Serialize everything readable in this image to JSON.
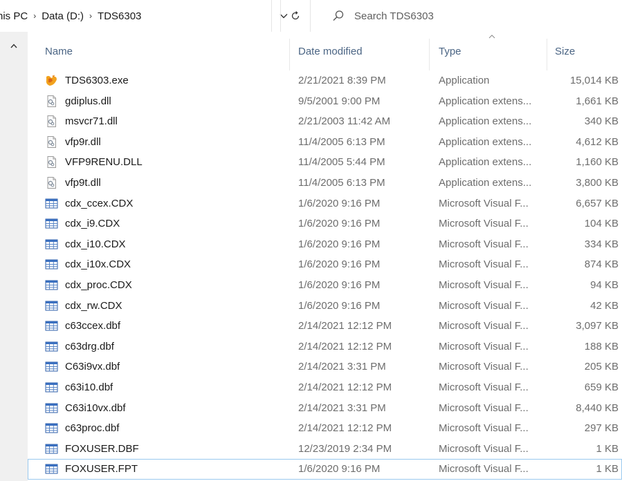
{
  "breadcrumb": [
    "his PC",
    "Data (D:)",
    "TDS6303"
  ],
  "search": {
    "placeholder": "Search TDS6303"
  },
  "columns": {
    "name": "Name",
    "date": "Date modified",
    "type": "Type",
    "size": "Size"
  },
  "colors": {
    "header_text": "#4b6584",
    "detail_text": "#6d6d6d",
    "gutter": "#f0f0f0",
    "focus_outline": "#99c9ef"
  },
  "files": [
    {
      "name": "TDS6303.exe",
      "date": "2/21/2021 8:39 PM",
      "type": "Application",
      "size": "15,014 KB",
      "icon": "application-icon"
    },
    {
      "name": "gdiplus.dll",
      "date": "9/5/2001 9:00 PM",
      "type": "Application extens...",
      "size": "1,661 KB",
      "icon": "dll-file-icon"
    },
    {
      "name": "msvcr71.dll",
      "date": "2/21/2003 11:42 AM",
      "type": "Application extens...",
      "size": "340 KB",
      "icon": "dll-file-icon"
    },
    {
      "name": "vfp9r.dll",
      "date": "11/4/2005 6:13 PM",
      "type": "Application extens...",
      "size": "4,612 KB",
      "icon": "dll-file-icon"
    },
    {
      "name": "VFP9RENU.DLL",
      "date": "11/4/2005 5:44 PM",
      "type": "Application extens...",
      "size": "1,160 KB",
      "icon": "dll-file-icon"
    },
    {
      "name": "vfp9t.dll",
      "date": "11/4/2005 6:13 PM",
      "type": "Application extens...",
      "size": "3,800 KB",
      "icon": "dll-file-icon"
    },
    {
      "name": "cdx_ccex.CDX",
      "date": "1/6/2020 9:16 PM",
      "type": "Microsoft Visual F...",
      "size": "6,657 KB",
      "icon": "table-file-icon"
    },
    {
      "name": "cdx_i9.CDX",
      "date": "1/6/2020 9:16 PM",
      "type": "Microsoft Visual F...",
      "size": "104 KB",
      "icon": "table-file-icon"
    },
    {
      "name": "cdx_i10.CDX",
      "date": "1/6/2020 9:16 PM",
      "type": "Microsoft Visual F...",
      "size": "334 KB",
      "icon": "table-file-icon"
    },
    {
      "name": "cdx_i10x.CDX",
      "date": "1/6/2020 9:16 PM",
      "type": "Microsoft Visual F...",
      "size": "874 KB",
      "icon": "table-file-icon"
    },
    {
      "name": "cdx_proc.CDX",
      "date": "1/6/2020 9:16 PM",
      "type": "Microsoft Visual F...",
      "size": "94 KB",
      "icon": "table-file-icon"
    },
    {
      "name": "cdx_rw.CDX",
      "date": "1/6/2020 9:16 PM",
      "type": "Microsoft Visual F...",
      "size": "42 KB",
      "icon": "table-file-icon"
    },
    {
      "name": "c63ccex.dbf",
      "date": "2/14/2021 12:12 PM",
      "type": "Microsoft Visual F...",
      "size": "3,097 KB",
      "icon": "table-file-icon"
    },
    {
      "name": "c63drg.dbf",
      "date": "2/14/2021 12:12 PM",
      "type": "Microsoft Visual F...",
      "size": "188 KB",
      "icon": "table-file-icon"
    },
    {
      "name": "C63i9vx.dbf",
      "date": "2/14/2021 3:31 PM",
      "type": "Microsoft Visual F...",
      "size": "205 KB",
      "icon": "table-file-icon"
    },
    {
      "name": "c63i10.dbf",
      "date": "2/14/2021 12:12 PM",
      "type": "Microsoft Visual F...",
      "size": "659 KB",
      "icon": "table-file-icon"
    },
    {
      "name": "C63i10vx.dbf",
      "date": "2/14/2021 3:31 PM",
      "type": "Microsoft Visual F...",
      "size": "8,440 KB",
      "icon": "table-file-icon"
    },
    {
      "name": "c63proc.dbf",
      "date": "2/14/2021 12:12 PM",
      "type": "Microsoft Visual F...",
      "size": "297 KB",
      "icon": "table-file-icon"
    },
    {
      "name": "FOXUSER.DBF",
      "date": "12/23/2019 2:34 PM",
      "type": "Microsoft Visual F...",
      "size": "1 KB",
      "icon": "table-file-icon"
    },
    {
      "name": "FOXUSER.FPT",
      "date": "1/6/2020 9:16 PM",
      "type": "Microsoft Visual F...",
      "size": "1 KB",
      "icon": "table-file-icon",
      "focused": true
    }
  ]
}
